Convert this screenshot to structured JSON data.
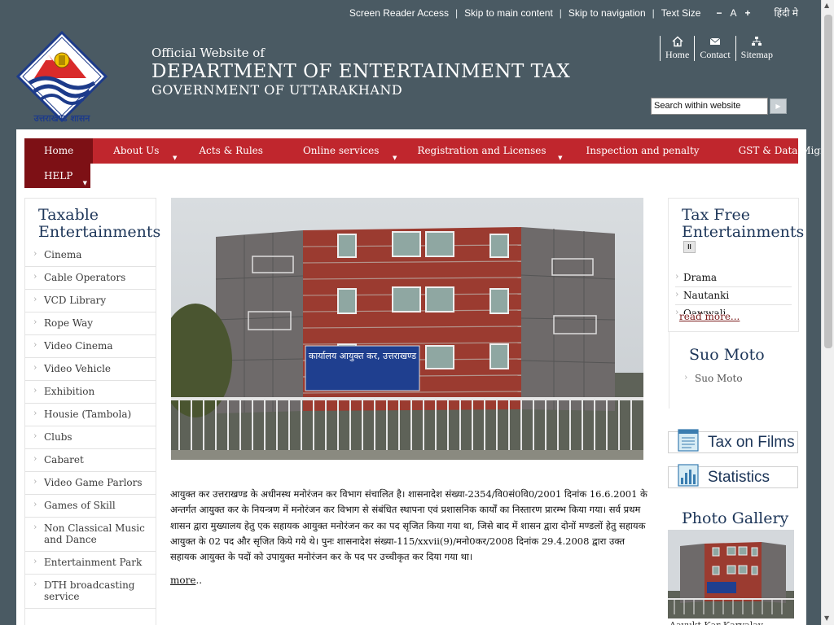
{
  "topbar": {
    "screen_reader": "Screen Reader Access",
    "skip_main": "Skip to main content",
    "skip_nav": "Skip to navigation",
    "text_size": "Text Size",
    "decrease": "−",
    "normal": "A",
    "increase": "+",
    "hindi": "हिंदी मे"
  },
  "header": {
    "logo_text": "उत्तराखण्ड शासन",
    "line1": "Official Website of",
    "line2": "DEPARTMENT OF ENTERTAINMENT TAX",
    "line3": "GOVERNMENT OF UTTARAKHAND"
  },
  "quicklinks": {
    "home": "Home",
    "contact": "Contact",
    "sitemap": "Sitemap"
  },
  "search": {
    "value": "Search within website"
  },
  "nav": {
    "items": [
      {
        "label": "Home",
        "active": true,
        "dropdown": false
      },
      {
        "label": "About Us",
        "dropdown": true
      },
      {
        "label": "Acts & Rules",
        "dropdown": false
      },
      {
        "label": "Online services",
        "dropdown": true
      },
      {
        "label": "Registration and Licenses",
        "dropdown": true
      },
      {
        "label": "Inspection and penalty",
        "dropdown": false
      },
      {
        "label": "GST & Data Migration",
        "dropdown": true
      }
    ],
    "help": "HELP"
  },
  "left": {
    "title": "Taxable Entertainments",
    "items": [
      "Cinema",
      "Cable Operators",
      "VCD Library",
      "Rope Way",
      "Video Cinema",
      "Video Vehicle",
      "Exhibition",
      "Housie (Tambola)",
      "Clubs",
      "Cabaret",
      "Video Game Parlors",
      "Games of Skill",
      "Non Classical Music and Dance",
      "Entertainment Park",
      "DTH broadcasting service"
    ]
  },
  "main": {
    "building_sign": "कार्यालय आयुक्त कर, उत्तराखण्ड",
    "intro": "आयुक्त कर उत्तराखण्ड के अधीनस्थ मनोरंजन कर विभाग संचालित है। शासनादेश संख्या-2354/वि0सं0वि0/2001 दिनांक 16.6.2001 के अन्तर्गत आयुक्त कर के नियन्त्रण में मनोरंजन कर विभाग से संबंधित स्थापना एवं प्रशासनिक कार्यों का निस्तारण प्रारम्भ किया गया। सर्व प्रथम शासन द्वारा मुख्यालय हेतु एक सहायक आयुक्त मनोरंजन कर का पद सृजित किया गया था, जिसे बाद में शासन द्वारा दोनों मण्डलों हेतु सहायक आयुक्त के 02 पद और सृजित किये गये थे। पुनः शासनादेश संख्या-115/xxvii(9)/मनो0कर/2008 दिनांक 29.4.2008 द्वारा उक्त सहायक आयुक्त के पदों को उपायुक्त मनोरंजन कर के पद पर उच्चीकृत कर दिया गया था।",
    "more": "more",
    "more_suffix": ".."
  },
  "right": {
    "taxfree_title": "Tax Free Entertainments",
    "pause": "II",
    "taxfree_items": [
      "Drama",
      "Nautanki",
      "Qawwali"
    ],
    "read_more": "read more...",
    "suomoto_title": "Suo Moto",
    "suomoto_item": "Suo Moto",
    "films": "Tax on Films",
    "stats": "Statistics",
    "gallery_title": "Photo Gallery",
    "gallery_caption": "Aayukt Kar Karyalay"
  },
  "colors": {
    "background": "#4a5a63",
    "nav_red": "#c0262d",
    "nav_active": "#7d1015",
    "heading_blue": "#1c3558"
  }
}
